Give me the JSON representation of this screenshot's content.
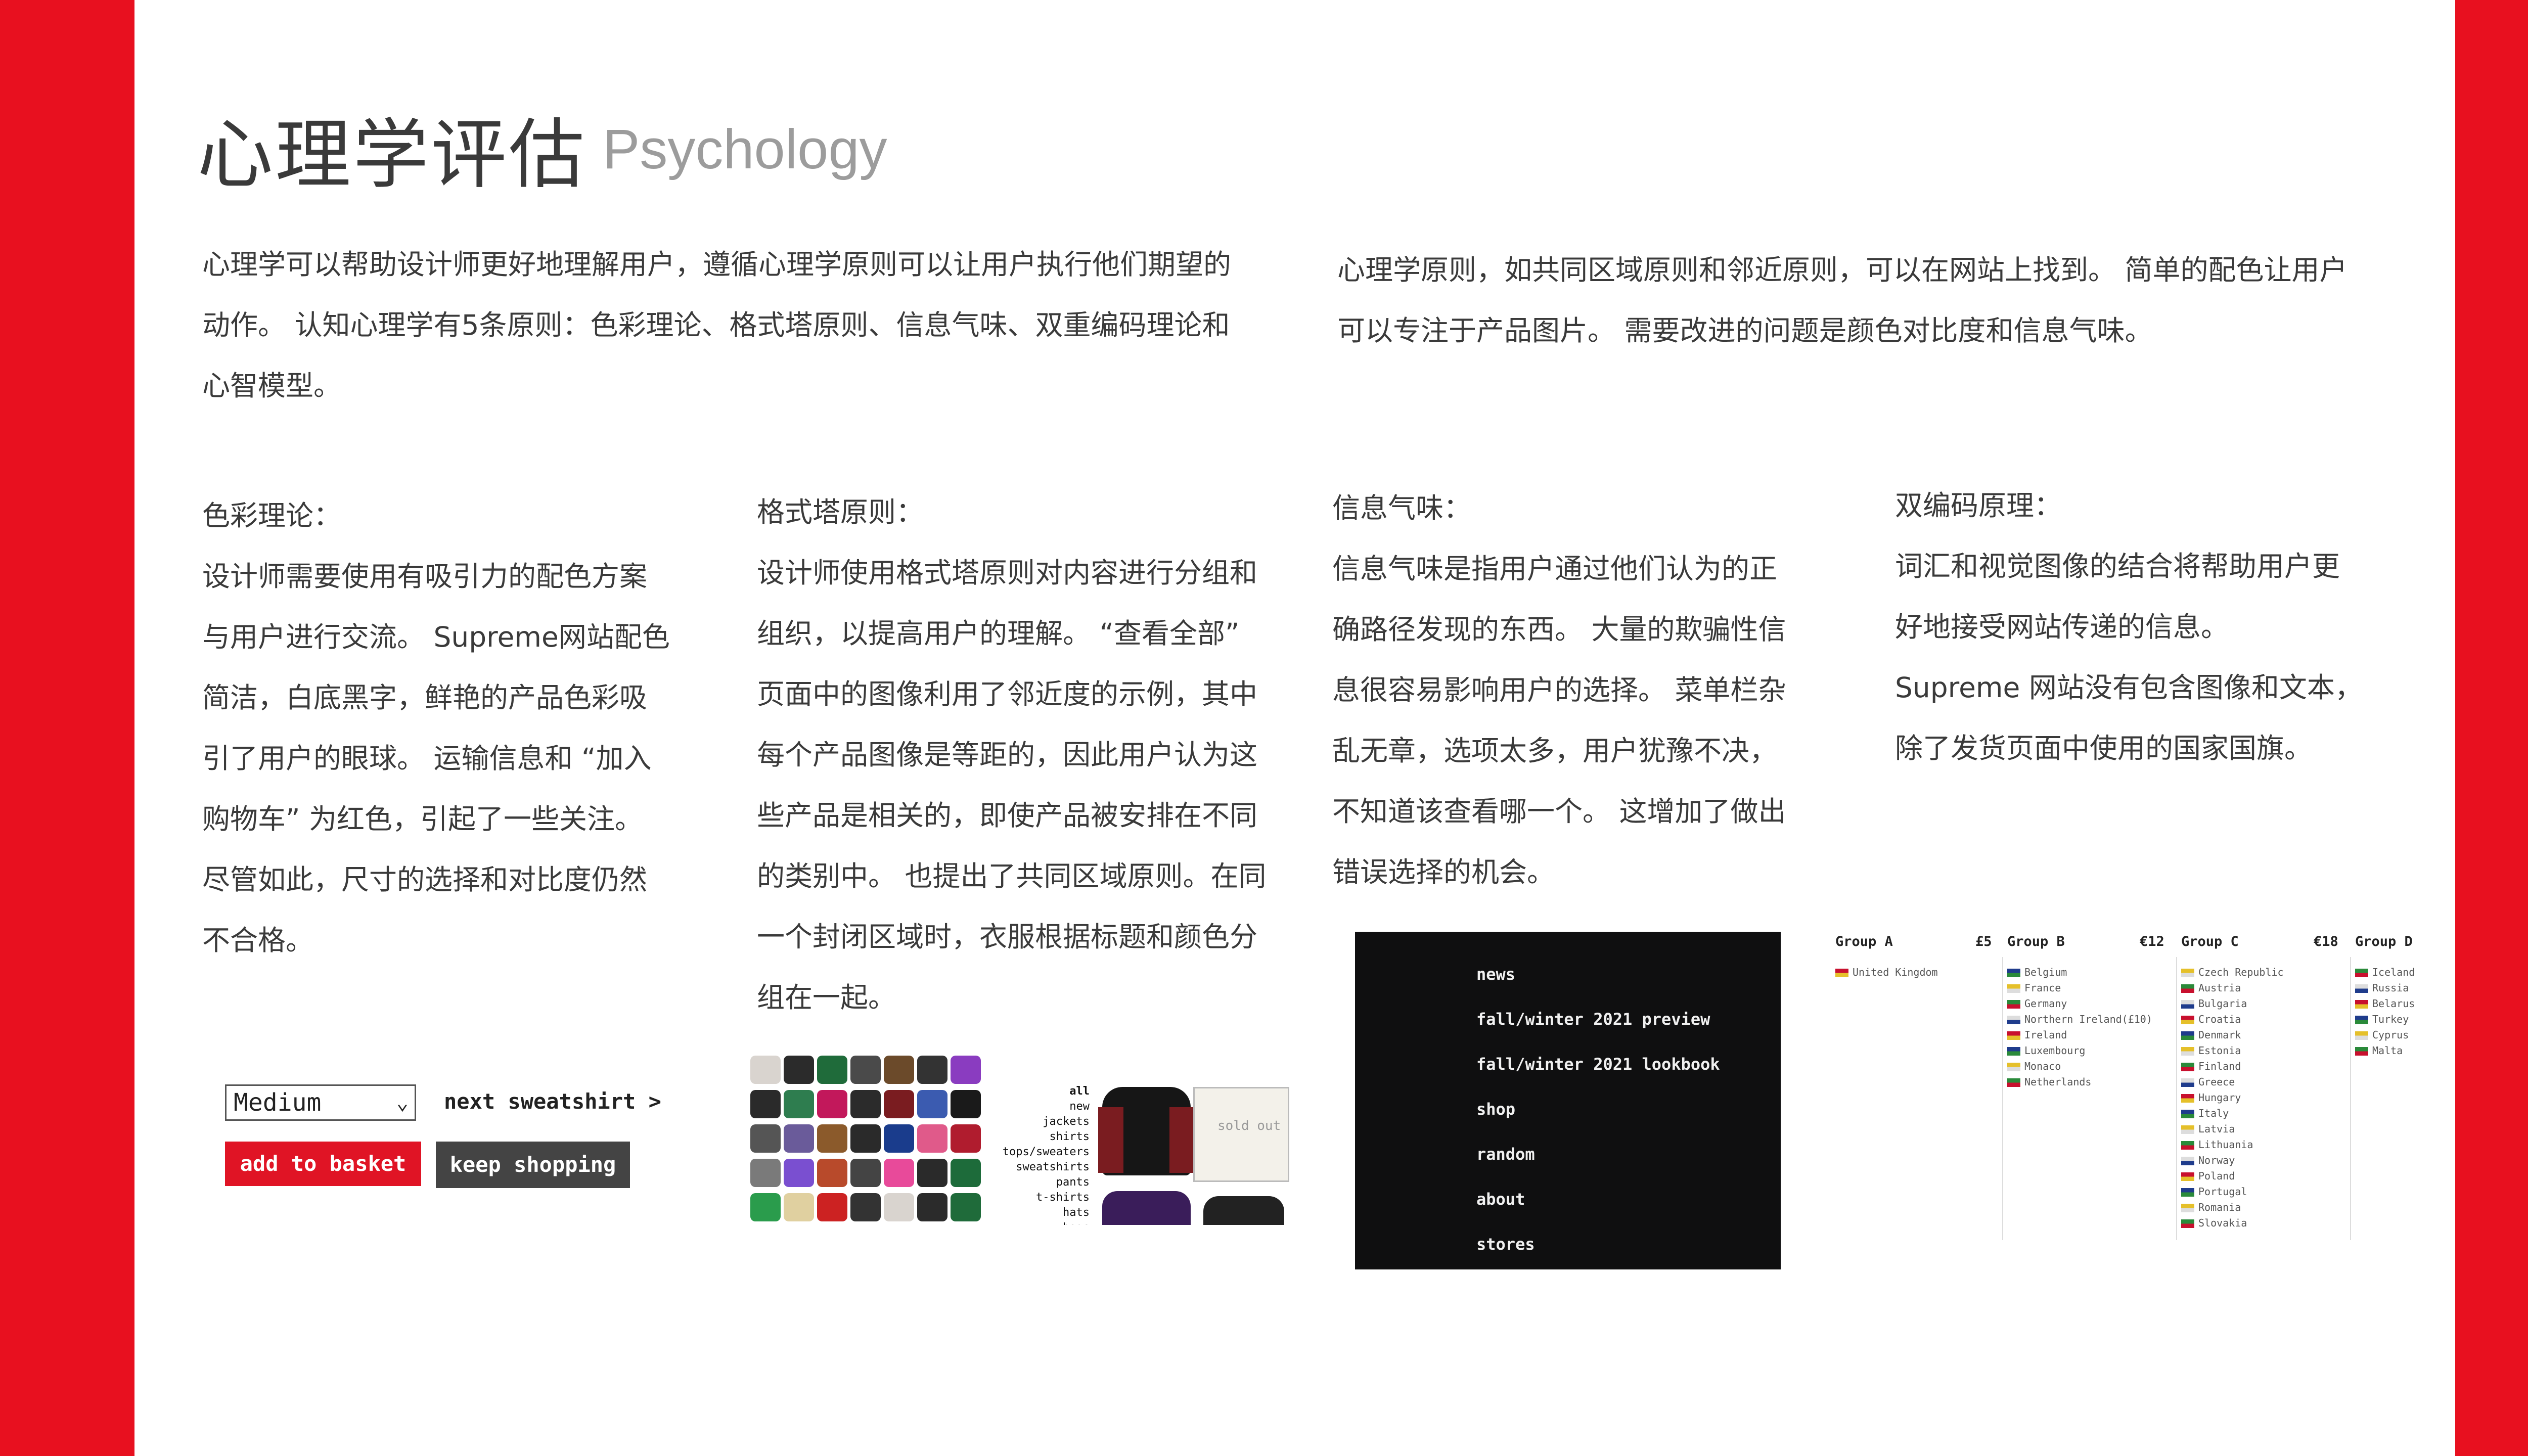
{
  "title": {
    "zh": "心理学评估",
    "en": "Psychology"
  },
  "intro_left": {
    "lines": [
      "心理学可以帮助设计师更好地理解用户，遵循心理学原则可以让用户执行他们期望的",
      "动作。 认知心理学有5条原则：色彩理论、格式塔原则、信息气味、双重编码理论和",
      "心智模型。"
    ]
  },
  "intro_right": {
    "lines": [
      "心理学原则，如共同区域原则和邻近原则，可以在网站上找到。 简单的配色让用户",
      "可以专注于产品图片。 需要改进的问题是颜色对比度和信息气味。"
    ]
  },
  "columns": [
    {
      "heading": "色彩理论：",
      "lines": [
        "设计师需要使用有吸引力的配色方案",
        "与用户进行交流。 Supreme网站配色",
        "简洁，白底黑字，鲜艳的产品色彩吸",
        "引了用户的眼球。 运输信息和 “加入",
        "购物车” 为红色，引起了一些关注。",
        "尽管如此，尺寸的选择和对比度仍然",
        "不合格。"
      ]
    },
    {
      "heading": "格式塔原则：",
      "lines": [
        "设计师使用格式塔原则对内容进行分组和",
        "组织，以提高用户的理解。 “查看全部”",
        "页面中的图像利用了邻近度的示例，其中",
        "每个产品图像是等距的，因此用户认为这",
        "些产品是相关的，即使产品被安排在不同",
        "的类别中。 也提出了共同区域原则。在同",
        "一个封闭区域时，衣服根据标题和颜色分",
        "组在一起。"
      ]
    },
    {
      "heading": "信息气味：",
      "lines": [
        "信息气味是指用户通过他们认为的正",
        "确路径发现的东西。 大量的欺骗性信",
        "息很容易影响用户的选择。 菜单栏杂",
        "乱无章，选项太多，用户犹豫不决，",
        "不知道该查看哪一个。 这增加了做出",
        "错误选择的机会。"
      ]
    },
    {
      "heading": "双编码原理：",
      "lines": [
        "词汇和视觉图像的结合将帮助用户更",
        "好地接受网站传递的信息。",
        "Supreme 网站没有包含图像和文本，",
        "除了发货页面中使用的国家国旗。"
      ]
    }
  ],
  "demo_cart": {
    "size_select": "Medium",
    "next_link": "next sweatshirt >",
    "add_button": "add to basket",
    "keep_button": "keep shopping"
  },
  "demo_shop": {
    "categories": [
      "all",
      "new",
      "jackets",
      "shirts",
      "tops/sweaters",
      "sweatshirts",
      "pants",
      "t-shirts",
      "hats",
      "bags"
    ],
    "sold_out": "sold out"
  },
  "demo_menu": {
    "items": [
      "news",
      "fall/winter 2021 preview",
      "fall/winter 2021 lookbook",
      "shop",
      "random",
      "about",
      "stores"
    ]
  },
  "demo_shipping": {
    "groups": [
      {
        "name": "Group A",
        "price": "£5",
        "countries": [
          "United Kingdom"
        ]
      },
      {
        "name": "Group B",
        "price": "€12",
        "countries": [
          "Belgium",
          "France",
          "Germany",
          "Northern Ireland(£10)",
          "Ireland",
          "Luxembourg",
          "Monaco",
          "Netherlands"
        ]
      },
      {
        "name": "Group C",
        "price": "€18",
        "countries": [
          "Czech Republic",
          "Austria",
          "Bulgaria",
          "Croatia",
          "Denmark",
          "Estonia",
          "Finland",
          "Greece",
          "Hungary",
          "Italy",
          "Latvia",
          "Lithuania",
          "Norway",
          "Poland",
          "Portugal",
          "Romania",
          "Slovakia"
        ]
      },
      {
        "name": "Group D",
        "price": "",
        "countries": [
          "Iceland",
          "Russia",
          "Belarus",
          "Turkey",
          "Cyprus",
          "Malta"
        ]
      }
    ]
  },
  "colors": {
    "brand_red": "#e8101f",
    "button_red": "#e01425",
    "text": "#3a3a3a"
  }
}
